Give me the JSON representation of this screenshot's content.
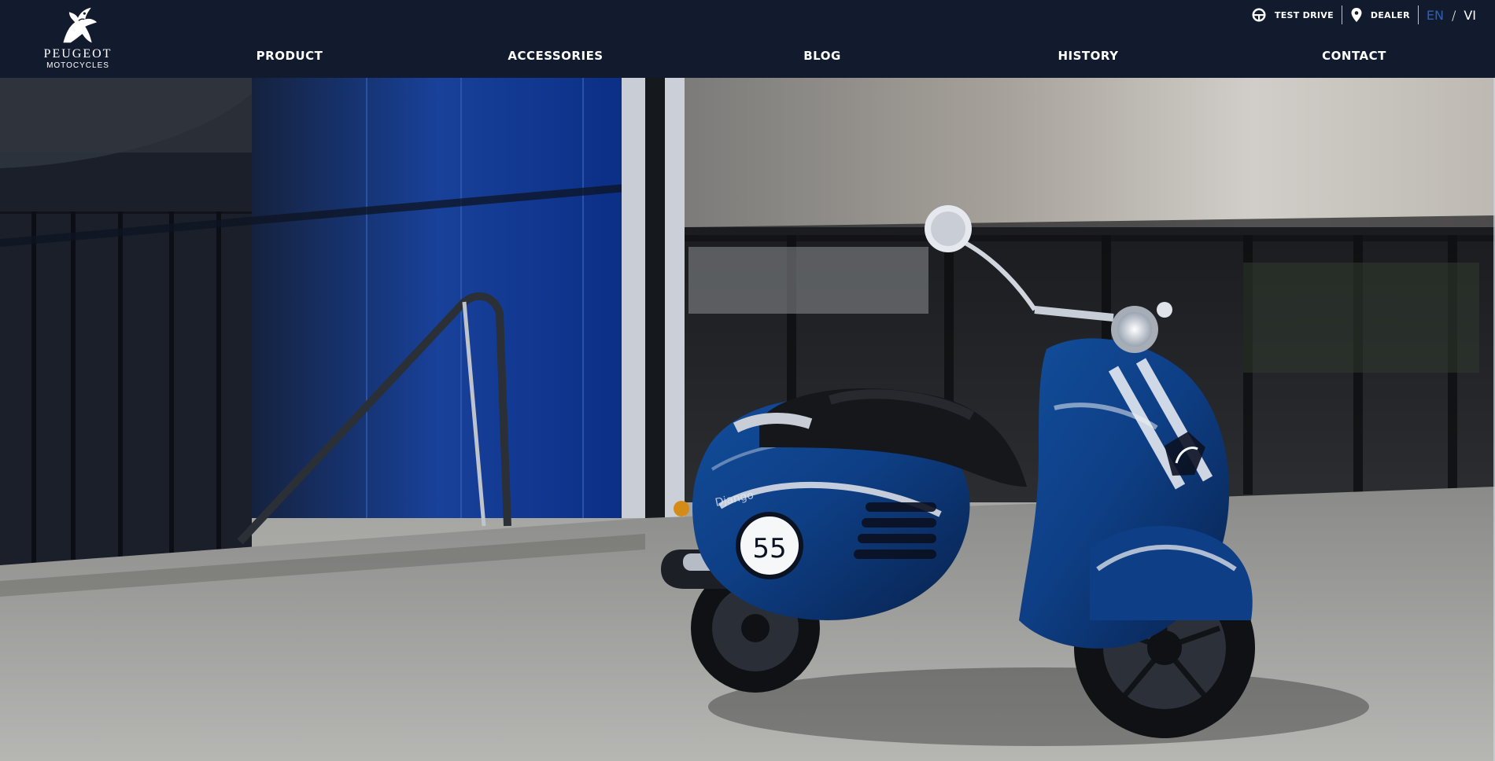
{
  "brand": {
    "name": "PEUGEOT",
    "sub": "MOTOCYCLES"
  },
  "nav": {
    "items": [
      {
        "label": "PRODUCT"
      },
      {
        "label": "ACCESSORIES"
      },
      {
        "label": "BLOG"
      },
      {
        "label": "HISTORY"
      },
      {
        "label": "CONTACT"
      }
    ]
  },
  "utility": {
    "test_drive": "TEST DRIVE",
    "dealer": "DEALER",
    "lang_en": "EN",
    "lang_sep": "/",
    "lang_vi": "VI"
  },
  "hero": {
    "scooter_number": "55",
    "scooter_script": "Django"
  },
  "colors": {
    "header_bg": "#121b2e",
    "accent_blue": "#2f5fb5",
    "scooter_blue": "#0e3f86"
  },
  "icons": {
    "test_drive": "steering-wheel-icon",
    "dealer": "map-pin-icon"
  }
}
